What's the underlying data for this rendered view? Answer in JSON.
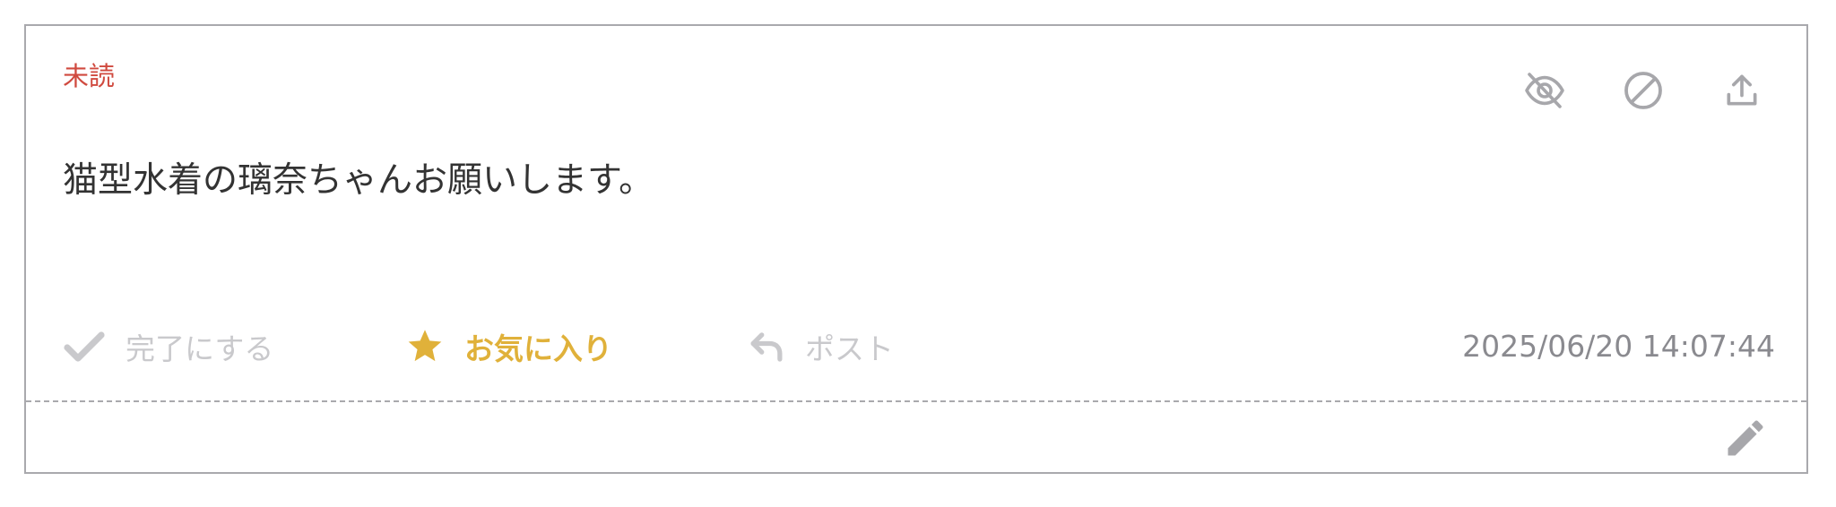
{
  "card": {
    "status_label": "未読",
    "message": "猫型水着の璃奈ちゃんお願いします。",
    "timestamp": "2025/06/20 14:07:44"
  },
  "top_actions": [
    {
      "name": "hide",
      "icon": "eye-slash-icon"
    },
    {
      "name": "block",
      "icon": "ban-icon"
    },
    {
      "name": "share",
      "icon": "upload-icon"
    }
  ],
  "actions": {
    "done_label": "完了にする",
    "favorite_label": "お気に入り",
    "post_label": "ポスト"
  },
  "edit": {
    "icon": "pencil-icon"
  },
  "colors": {
    "status": "#d04a3f",
    "favorite": "#e0b13a",
    "muted": "#c9c9cc",
    "icon": "#a7a7ab",
    "text": "#333333",
    "timestamp": "#8a8a8f",
    "border": "#a9a9ad"
  }
}
